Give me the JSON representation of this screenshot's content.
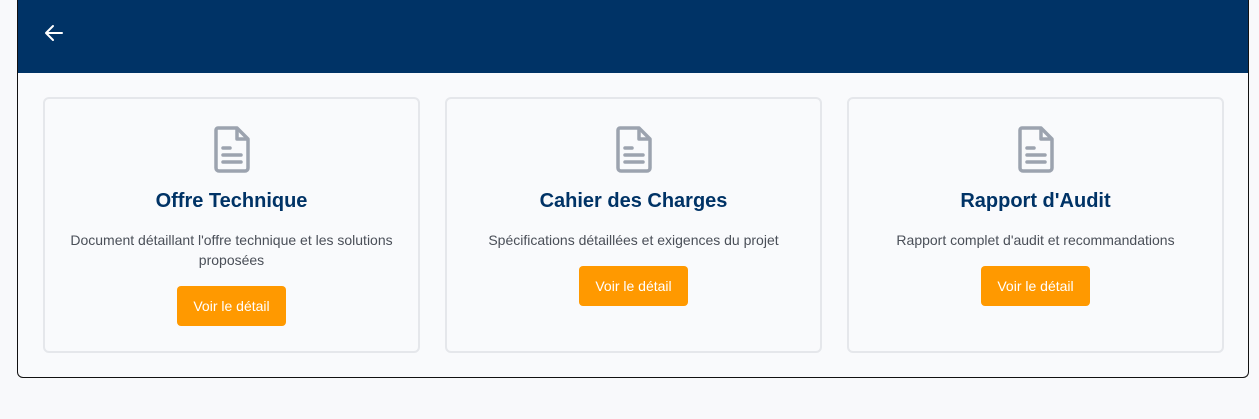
{
  "header": {
    "back_icon": "arrow-left-icon"
  },
  "cards": [
    {
      "icon": "document-icon",
      "title": "Offre Technique",
      "description": "Document détaillant l'offre technique et les solutions proposées",
      "button_label": "Voir le détail"
    },
    {
      "icon": "document-icon",
      "title": "Cahier des Charges",
      "description": "Spécifications détaillées et exigences du projet",
      "button_label": "Voir le détail"
    },
    {
      "icon": "document-icon",
      "title": "Rapport d'Audit",
      "description": "Rapport complet d'audit et recommandations",
      "button_label": "Voir le détail"
    }
  ],
  "colors": {
    "header_bg": "#003366",
    "title": "#003366",
    "button_bg": "#ff9900",
    "icon": "#9ca3af"
  }
}
